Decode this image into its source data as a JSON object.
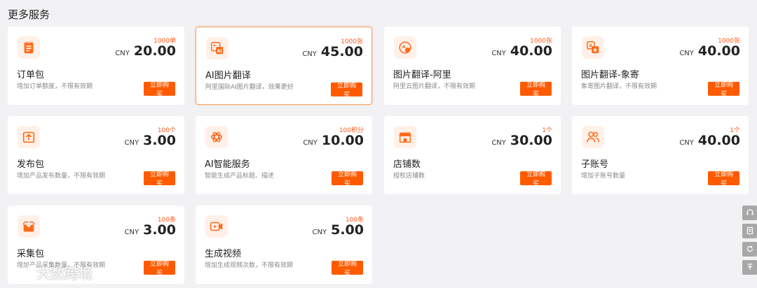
{
  "page": {
    "title": "更多服务"
  },
  "buy_label": "立即购买",
  "currency": "CNY",
  "accent_color": "#ff5a00",
  "cards": [
    {
      "name": "订单包",
      "desc": "增加订单额度，不限有效期",
      "qty": "1000单",
      "amount": "20.00",
      "icon": "clipboard-icon"
    },
    {
      "name": "AI图片翻译",
      "desc": "阿里国际AI图片翻译，效果更好",
      "qty": "1000张",
      "amount": "45.00",
      "icon": "ai-image-icon"
    },
    {
      "name": "图片翻译-阿里",
      "desc": "阿里云图片翻译，不限有效期",
      "qty": "1000张",
      "amount": "40.00",
      "icon": "translate-icon"
    },
    {
      "name": "图片翻译-象寄",
      "desc": "象寄图片翻译，不限有效期",
      "qty": "1000张",
      "amount": "40.00",
      "icon": "translate-ab-icon"
    },
    {
      "name": "发布包",
      "desc": "增加产品发布数量，不限有效期",
      "qty": "100个",
      "amount": "3.00",
      "icon": "upload-icon"
    },
    {
      "name": "AI智能服务",
      "desc": "智能生成产品标题、描述",
      "qty": "100积分",
      "amount": "10.00",
      "icon": "ai-knot-icon"
    },
    {
      "name": "店铺数",
      "desc": "授权店铺数",
      "qty": "1个",
      "amount": "30.00",
      "icon": "store-icon"
    },
    {
      "name": "子账号",
      "desc": "增加子账号数量",
      "qty": "1个",
      "amount": "40.00",
      "icon": "users-icon"
    },
    {
      "name": "采集包",
      "desc": "增加产品采集数量，不限有效期",
      "qty": "100条",
      "amount": "3.00",
      "icon": "box-icon"
    },
    {
      "name": "生成视频",
      "desc": "增加生成视频次数，不限有效期",
      "qty": "100条",
      "amount": "5.00",
      "icon": "video-icon"
    }
  ],
  "sidebar_tools": [
    "headset-icon",
    "notepad-icon",
    "refresh-icon",
    "back-to-top-icon"
  ],
  "watermark": {
    "text": "大数跨境"
  }
}
